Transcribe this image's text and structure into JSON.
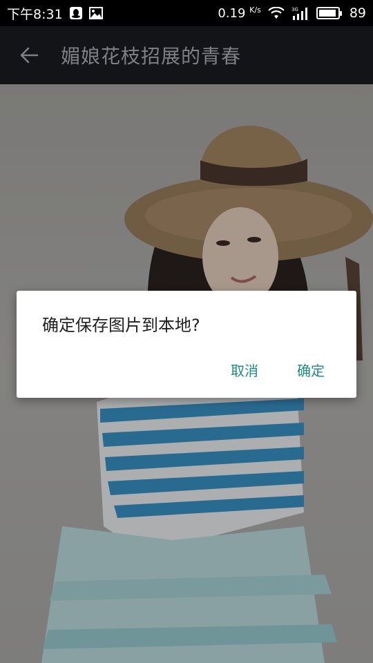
{
  "status_bar": {
    "time": "下午8:31",
    "net_speed": "0.19",
    "net_unit": "K/s",
    "network_type": "3G",
    "battery": "89",
    "icons": [
      "qq-icon",
      "image-icon",
      "wifi-icon",
      "signal-icon",
      "battery-icon"
    ]
  },
  "toolbar": {
    "title": "媚娘花枝招展的青春",
    "back_icon": "arrow-back-icon"
  },
  "dialog": {
    "message": "确定保存图片到本地?",
    "cancel_label": "取消",
    "confirm_label": "确定"
  },
  "colors": {
    "toolbar_bg": "#121417",
    "title_color": "#7d8085",
    "accent": "#1c8b85"
  }
}
